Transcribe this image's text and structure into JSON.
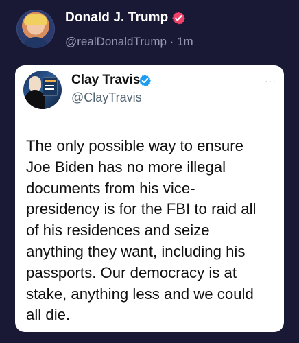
{
  "post": {
    "author": "Donald J. Trump",
    "meta": "@realDonaldTrump · 1m"
  },
  "quoted": {
    "name": "Clay Travis",
    "handle": "@ClayTravis",
    "text": "The only possible way to ensure\nJoe Biden has no more illegal\ndocuments from his vice-\npresidency is for the FBI to raid all\nof his residences and seize\nanything they want, including his\npassports. Our democracy is at\nstake, anything less and we could\nall die."
  },
  "icons": {
    "more": "···"
  },
  "colors": {
    "background": "#191835",
    "card": "#ffffff",
    "verified_primary": "#f0416b",
    "verified_quoted": "#1d9bf0",
    "meta_text": "#9a99b4",
    "handle_text": "#536471"
  }
}
